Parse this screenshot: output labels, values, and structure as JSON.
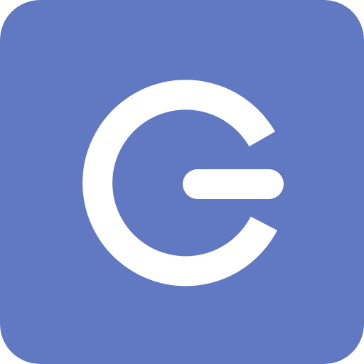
{
  "icon": {
    "name": "power-icon",
    "background_color": "#6178C2",
    "glyph_color": "#FFFFFF"
  }
}
